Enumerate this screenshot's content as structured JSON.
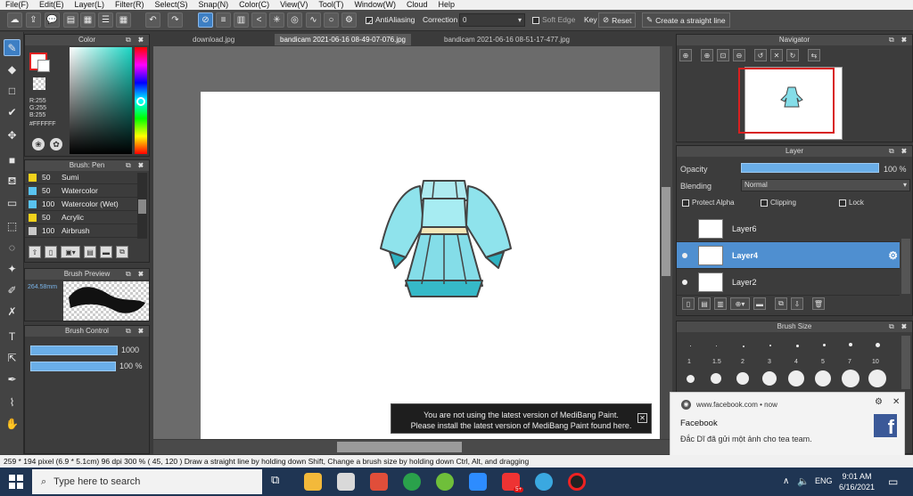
{
  "menu": [
    "File(F)",
    "Edit(E)",
    "Layer(L)",
    "Filter(R)",
    "Select(S)",
    "Snap(N)",
    "Color(C)",
    "View(V)",
    "Tool(T)",
    "Window(W)",
    "Cloud",
    "Help"
  ],
  "toolbar": {
    "antialiasing_label": "AntiAliasing",
    "correction_label": "Correction",
    "correction_value": "0",
    "soft_edge_label": "Soft Edge",
    "key_label": "Key",
    "reset_label": "Reset",
    "straight_line_label": "Create a straight line"
  },
  "color_panel": {
    "title": "Color",
    "r": "R:255",
    "g": "G:255",
    "b": "B:255",
    "hex": "#FFFFFF",
    "primary": "#ffffff",
    "accent": "#e02020"
  },
  "brush_panel": {
    "title": "Brush: Pen",
    "items": [
      {
        "size": "50",
        "name": "Sumi",
        "color": "#f2d21b"
      },
      {
        "size": "50",
        "name": "Watercolor",
        "color": "#59c3f0"
      },
      {
        "size": "100",
        "name": "Watercolor (Wet)",
        "color": "#59c3f0"
      },
      {
        "size": "50",
        "name": "Acrylic",
        "color": "#f2d21b"
      },
      {
        "size": "100",
        "name": "Airbrush",
        "color": "#c8c8c8"
      }
    ]
  },
  "brush_preview": {
    "title": "Brush Preview",
    "size": "264.58mm"
  },
  "brush_control": {
    "title": "Brush Control",
    "size_value": "1000",
    "opacity_value": "100 %"
  },
  "tabs": [
    "download.jpg",
    "bandicam 2021-06-16 08-49-07-076.jpg",
    "bandicam 2021-06-16 08-51-17-477.jpg"
  ],
  "navigator": {
    "title": "Navigator"
  },
  "layer_panel": {
    "title": "Layer",
    "opacity_label": "Opacity",
    "opacity_value": "100 %",
    "blending_label": "Blending",
    "blending_value": "Normal",
    "protect_alpha": "Protect Alpha",
    "clipping": "Clipping",
    "lock": "Lock",
    "layers": [
      {
        "name": "Layer6"
      },
      {
        "name": "Layer4"
      },
      {
        "name": "Layer2"
      }
    ]
  },
  "brush_size": {
    "title": "Brush Size",
    "labels": [
      "1",
      "1.5",
      "2",
      "3",
      "4",
      "5",
      "7",
      "10"
    ]
  },
  "update_notice": {
    "line1": "You are not using the latest version of MediBang Paint.",
    "line2": "Please install the latest version of MediBang Paint found here."
  },
  "toast": {
    "source": "www.facebook.com • now",
    "title": "Facebook",
    "message": "Đắc Dĩ đã gửi một ảnh cho tea team."
  },
  "status": {
    "text": "259 * 194 pixel   (6.9 * 5.1cm)   96 dpi   300 %   ( 45, 120 )   Draw a straight line by holding down Shift, Change a brush size by holding down Ctrl, Alt, and dragging"
  },
  "taskbar": {
    "search_placeholder": "Type here to search",
    "language": "ENG",
    "time": "9:01 AM",
    "date": "6/16/2021",
    "badge": "5+"
  }
}
